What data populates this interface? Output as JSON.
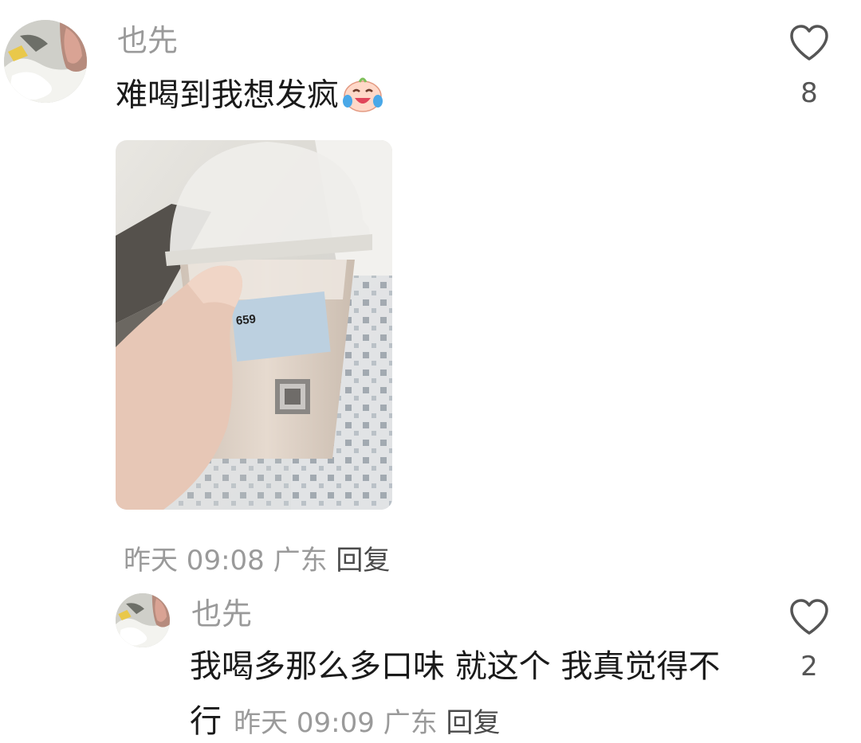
{
  "comments": [
    {
      "username": "也先",
      "text": "难喝到我想发疯",
      "emoji": "crying-laughing-emoji",
      "has_image": true,
      "image_description": "photo-of-milk-tea-cup",
      "cup_label_number": "659",
      "time": "昨天 09:08",
      "location": "广东",
      "reply_label": "回复",
      "likes": "8"
    },
    {
      "username": "也先",
      "text_line1": "我喝多那么多口味 就这个 我真觉得不",
      "text_line2": "行",
      "time": "昨天 09:09",
      "location": "广东",
      "reply_label": "回复",
      "likes": "2"
    }
  ],
  "colors": {
    "username": "#9a9a9a",
    "text": "#1a1a1a",
    "meta": "#9a9a9a",
    "reply": "#4a4a4a",
    "icon": "#555555"
  },
  "icons": [
    "heart-outline-icon"
  ]
}
